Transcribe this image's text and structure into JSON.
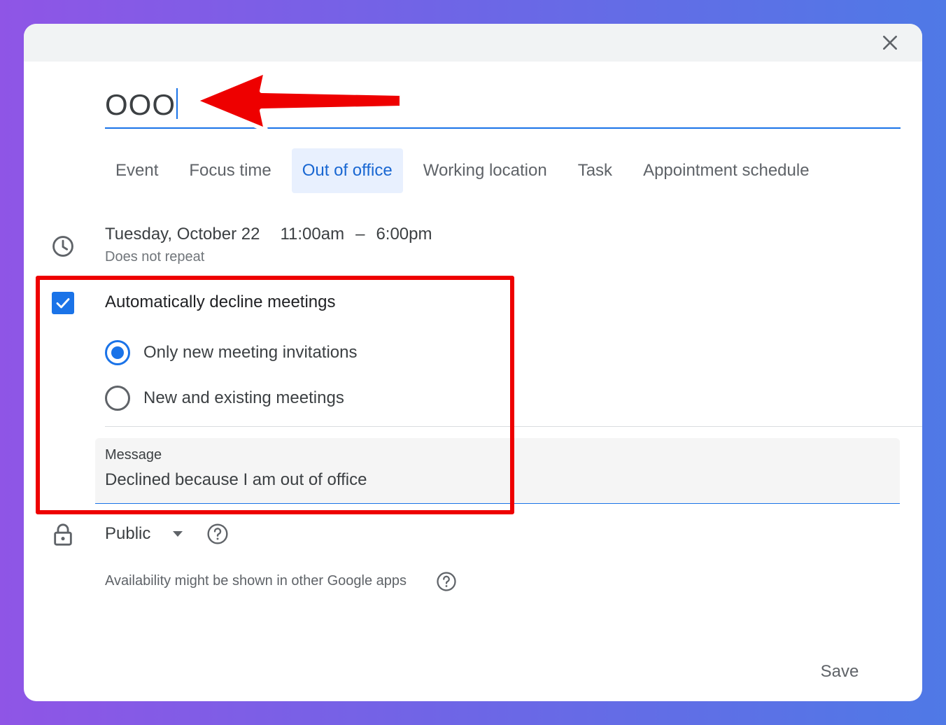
{
  "dialog": {
    "close_icon": "close-icon",
    "title": {
      "value": "OOO",
      "arrow_color": "#ee0000"
    },
    "tabs": [
      {
        "label": "Event",
        "active": false
      },
      {
        "label": "Focus time",
        "active": false
      },
      {
        "label": "Out of office",
        "active": true
      },
      {
        "label": "Working location",
        "active": false
      },
      {
        "label": "Task",
        "active": false
      },
      {
        "label": "Appointment schedule",
        "active": false
      }
    ],
    "schedule": {
      "icon": "clock-icon",
      "date": "Tuesday, October 22",
      "start_time": "11:00am",
      "separator": "–",
      "end_time": "6:00pm",
      "repeat": "Does not repeat"
    },
    "auto_decline": {
      "checked": true,
      "label": "Automatically decline meetings",
      "options": [
        {
          "label": "Only new meeting invitations",
          "selected": true
        },
        {
          "label": "New and existing meetings",
          "selected": false
        }
      ],
      "message": {
        "label": "Message",
        "value": "Declined because I am out of office"
      },
      "highlight_color": "#ee0000"
    },
    "visibility": {
      "icon": "lock-icon",
      "value": "Public",
      "help_icon": "help-icon"
    },
    "availability_note": "Availability might be shown in other Google apps",
    "save_label": "Save"
  },
  "colors": {
    "accent": "#1a73e8",
    "active_tab_bg": "#e8f0fe",
    "annotation": "#ee0000",
    "background_gradient": [
      "#8f55e6",
      "#4f79e6"
    ]
  }
}
